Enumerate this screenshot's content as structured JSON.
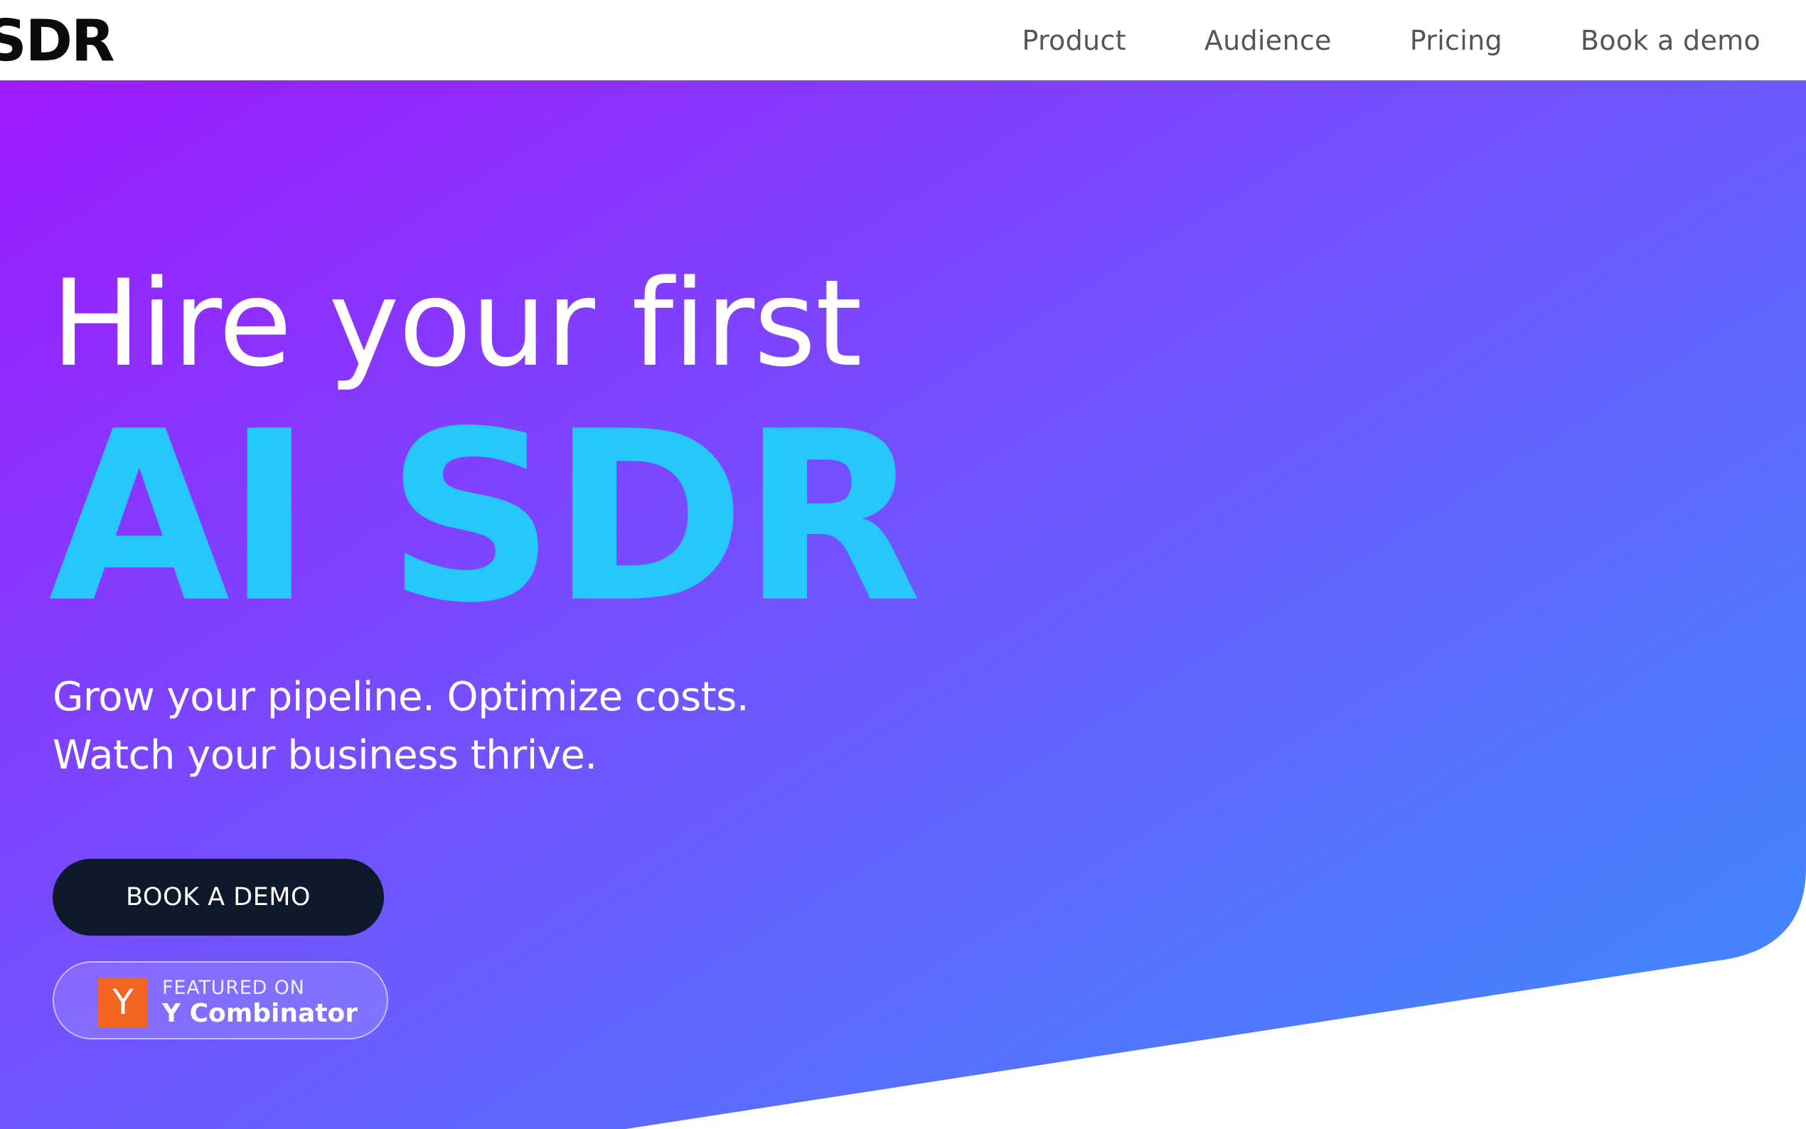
{
  "header": {
    "logo_text": "SDR",
    "nav": [
      {
        "label": "Product"
      },
      {
        "label": "Audience"
      },
      {
        "label": "Pricing"
      },
      {
        "label": "Book a demo"
      }
    ]
  },
  "hero": {
    "headline_line1": "Hire your first",
    "headline_line2": "AI SDR",
    "subtitle_line1": "Grow your pipeline. Optimize costs.",
    "subtitle_line2": "Watch your business thrive.",
    "cta_label": "BOOK A DEMO",
    "badge": {
      "logo_letter": "Y",
      "featured_label": "FEATURED ON",
      "name": "Y Combinator"
    }
  },
  "colors": {
    "gradient_start": "#a215ff",
    "gradient_end": "#3a8efd",
    "accent": "#26c8fb",
    "cta_bg": "#0e1a2b",
    "yc_orange": "#f26522",
    "nav_text": "#555555"
  }
}
